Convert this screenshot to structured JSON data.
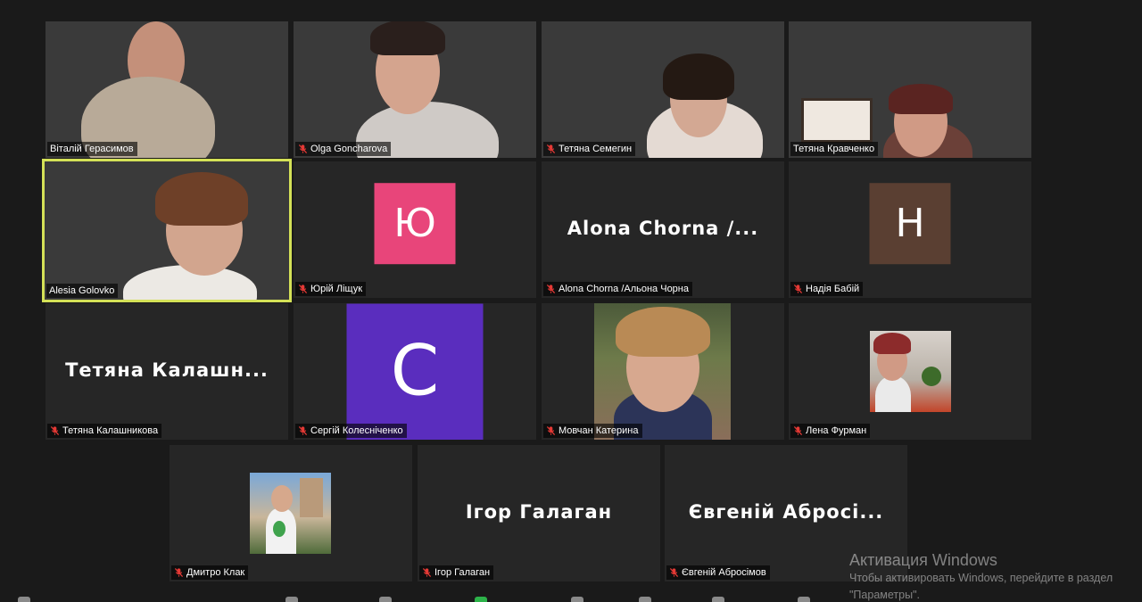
{
  "participants": [
    {
      "name": "Віталій Герасимов",
      "muted": false,
      "type": "video",
      "bg": "bg-room1"
    },
    {
      "name": "Olga Goncharova",
      "muted": true,
      "type": "video",
      "bg": "bg-room2"
    },
    {
      "name": "Тетяна Семегин",
      "muted": true,
      "type": "video",
      "bg": "bg-room3"
    },
    {
      "name": "Тетяна Кравченко",
      "muted": false,
      "type": "video",
      "bg": "bg-room4"
    },
    {
      "name": "Alesia Golovko",
      "muted": false,
      "type": "video",
      "bg": "bg-room5",
      "active": true
    },
    {
      "name": "Юрій Ліщук",
      "muted": true,
      "type": "avatar",
      "avatar_letter": "Ю",
      "avatar_color": "#e8457a"
    },
    {
      "name": "Alona Chorna /Альона Чорна",
      "muted": true,
      "type": "text",
      "display_name": "Alona  Chorna  /..."
    },
    {
      "name": "Надія Бабій",
      "muted": true,
      "type": "avatar",
      "avatar_letter": "Н",
      "avatar_color": "#5a3f32"
    },
    {
      "name": "Тетяна Калашникова",
      "muted": true,
      "type": "text",
      "display_name": "Тетяна  Калашн..."
    },
    {
      "name": "Сергій Колесніченко",
      "muted": true,
      "type": "avatar",
      "avatar_letter": "С",
      "avatar_color": "#5a2dbe"
    },
    {
      "name": "Мовчан Катерина",
      "muted": true,
      "type": "photo"
    },
    {
      "name": "Лена Фурман",
      "muted": true,
      "type": "photo"
    },
    {
      "name": "Дмитро Клак",
      "muted": true,
      "type": "photo"
    },
    {
      "name": "Ігор Галаган",
      "muted": true,
      "type": "text",
      "display_name": "Ігор  Галаган"
    },
    {
      "name": "Євгеній Абросімов",
      "muted": true,
      "type": "text",
      "display_name": "Євгеній  Абросі..."
    }
  ],
  "watermark": {
    "title": "Активация Windows",
    "line1": "Чтобы активировать Windows, перейдите в раздел",
    "line2": "\"Параметры\"."
  },
  "colors": {
    "active_speaker": "#d4e157",
    "tile_bg": "#262626",
    "page_bg": "#1a1a1a",
    "mute": "#e53935"
  }
}
